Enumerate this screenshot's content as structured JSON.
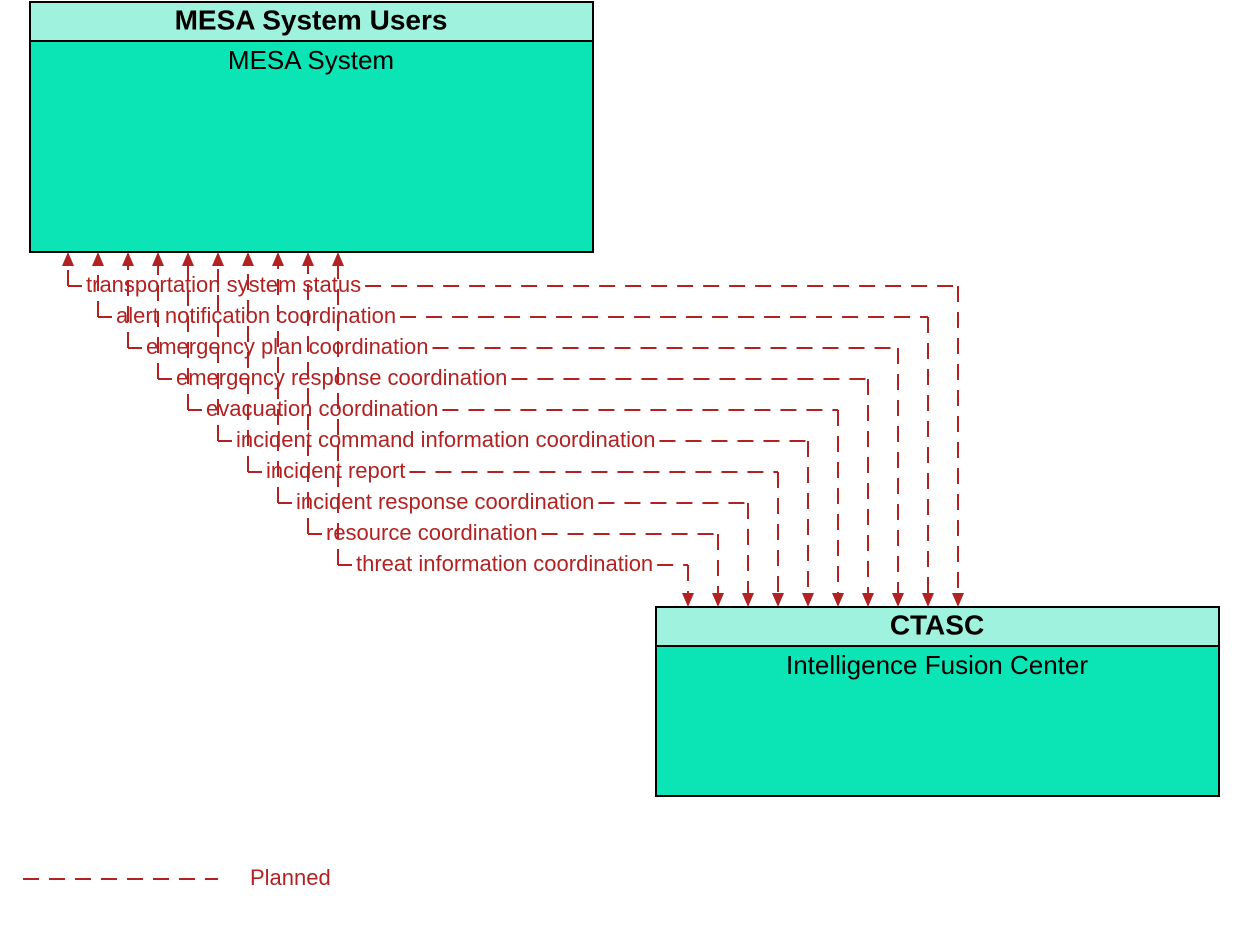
{
  "nodes": {
    "top": {
      "header": "MESA System Users",
      "body": "MESA System"
    },
    "bottom": {
      "header": "CTASC",
      "body": "Intelligence Fusion Center"
    }
  },
  "flows": [
    {
      "label": "transportation system status"
    },
    {
      "label": "alert notification coordination"
    },
    {
      "label": "emergency plan coordination"
    },
    {
      "label": "emergency response coordination"
    },
    {
      "label": "evacuation coordination"
    },
    {
      "label": "incident command information coordination"
    },
    {
      "label": "incident report"
    },
    {
      "label": "incident response coordination"
    },
    {
      "label": "resource coordination"
    },
    {
      "label": "threat information coordination"
    }
  ],
  "legend": {
    "planned": "Planned"
  },
  "colors": {
    "header_fill": "#9ff2dd",
    "body_fill": "#0be4b5",
    "flow_stroke": "#b22222"
  }
}
